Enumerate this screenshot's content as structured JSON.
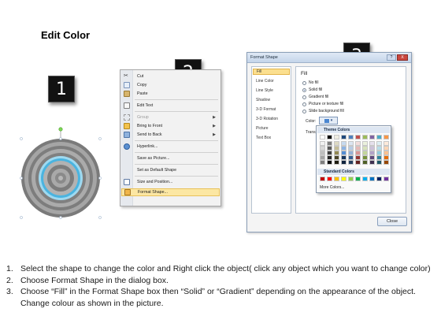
{
  "title": "Edit Color",
  "badges": [
    "1",
    "2",
    "3"
  ],
  "context_menu": {
    "items": [
      {
        "label": "Cut",
        "icon": "scissors-icon",
        "disabled": false,
        "submenu": false
      },
      {
        "label": "Copy",
        "icon": "copy-icon",
        "disabled": false,
        "submenu": false
      },
      {
        "label": "Paste",
        "icon": "paste-icon",
        "disabled": false,
        "submenu": false
      },
      {
        "label": "Edit Text",
        "icon": "edit-text-icon",
        "disabled": false,
        "submenu": false
      },
      {
        "label": "Group",
        "icon": "group-icon",
        "disabled": true,
        "submenu": true
      },
      {
        "label": "Bring to Front",
        "icon": "bring-to-front-icon",
        "disabled": false,
        "submenu": true
      },
      {
        "label": "Send to Back",
        "icon": "send-to-back-icon",
        "disabled": false,
        "submenu": true
      },
      {
        "label": "Hyperlink...",
        "icon": "hyperlink-icon",
        "disabled": false,
        "submenu": false
      },
      {
        "label": "Save as Picture...",
        "icon": "",
        "disabled": false,
        "submenu": false
      },
      {
        "label": "Set as Default Shape",
        "icon": "",
        "disabled": false,
        "submenu": false
      },
      {
        "label": "Size and Position...",
        "icon": "size-position-icon",
        "disabled": false,
        "submenu": false
      },
      {
        "label": "Format Shape...",
        "icon": "format-shape-icon",
        "disabled": false,
        "submenu": false,
        "highlighted": true
      }
    ]
  },
  "dialog": {
    "title": "Format Shape",
    "help": "?",
    "close_x": "X",
    "nav": [
      "Fill",
      "Line Color",
      "Line Style",
      "Shadow",
      "3-D Format",
      "3-D Rotation",
      "Picture",
      "Text Box"
    ],
    "nav_selected": "Fill",
    "fill_heading": "Fill",
    "options": [
      {
        "label": "No fill",
        "selected": false
      },
      {
        "label": "Solid fill",
        "selected": true
      },
      {
        "label": "Gradient fill",
        "selected": false
      },
      {
        "label": "Picture or texture fill",
        "selected": false
      },
      {
        "label": "Slide background fill",
        "selected": false
      }
    ],
    "color_label": "Color:",
    "color_button": "▾",
    "transparency_label": "Transpa",
    "close_button": "Close"
  },
  "color_picker": {
    "theme_heading": "Theme Colors",
    "standard_heading": "Standard Colors",
    "more_colors": "More Colors...",
    "theme_top": [
      "#ffffff",
      "#000000",
      "#eeece1",
      "#1f497d",
      "#4f81bd",
      "#c0504d",
      "#9bbb59",
      "#8064a2",
      "#4bacc6",
      "#f79646"
    ],
    "theme_shades": [
      [
        "#f2f2f2",
        "#7f7f7f",
        "#ddd9c3",
        "#c6d9f0",
        "#dbe5f1",
        "#f2dcdb",
        "#ebf1dd",
        "#e5e0ec",
        "#dbeef3",
        "#fdeada"
      ],
      [
        "#d8d8d8",
        "#595959",
        "#c4bd97",
        "#8db3e2",
        "#b8cce4",
        "#e5b9b7",
        "#d7e3bc",
        "#ccc1d9",
        "#b7dde8",
        "#fbd5b5"
      ],
      [
        "#bfbfbf",
        "#3f3f3f",
        "#938953",
        "#548dd4",
        "#95b3d7",
        "#d99694",
        "#c3d69b",
        "#b2a2c7",
        "#92cddc",
        "#fac08f"
      ],
      [
        "#a5a5a5",
        "#262626",
        "#494429",
        "#17365d",
        "#366092",
        "#953734",
        "#76923c",
        "#5f497a",
        "#31859b",
        "#e36c09"
      ],
      [
        "#7f7f7f",
        "#0c0c0c",
        "#1d1b10",
        "#0f243e",
        "#244061",
        "#632423",
        "#4f6128",
        "#3f3151",
        "#205867",
        "#974806"
      ]
    ],
    "standard": [
      "#c00000",
      "#ff0000",
      "#ffc000",
      "#ffff00",
      "#92d050",
      "#00b050",
      "#00b0f0",
      "#0070c0",
      "#002060",
      "#7030a0"
    ]
  },
  "steps": [
    {
      "num": "1.",
      "text": "Select the shape to change the color and Right click the object( click any object which you want to change color)"
    },
    {
      "num": "2.",
      "text": "Choose Format Shape in the dialog box."
    },
    {
      "num": "3.",
      "text": "Choose “Fill” in the Format Shape box then “Solid” or “Gradient” depending on the appearance of the object. Change colour as shown in the picture."
    }
  ]
}
